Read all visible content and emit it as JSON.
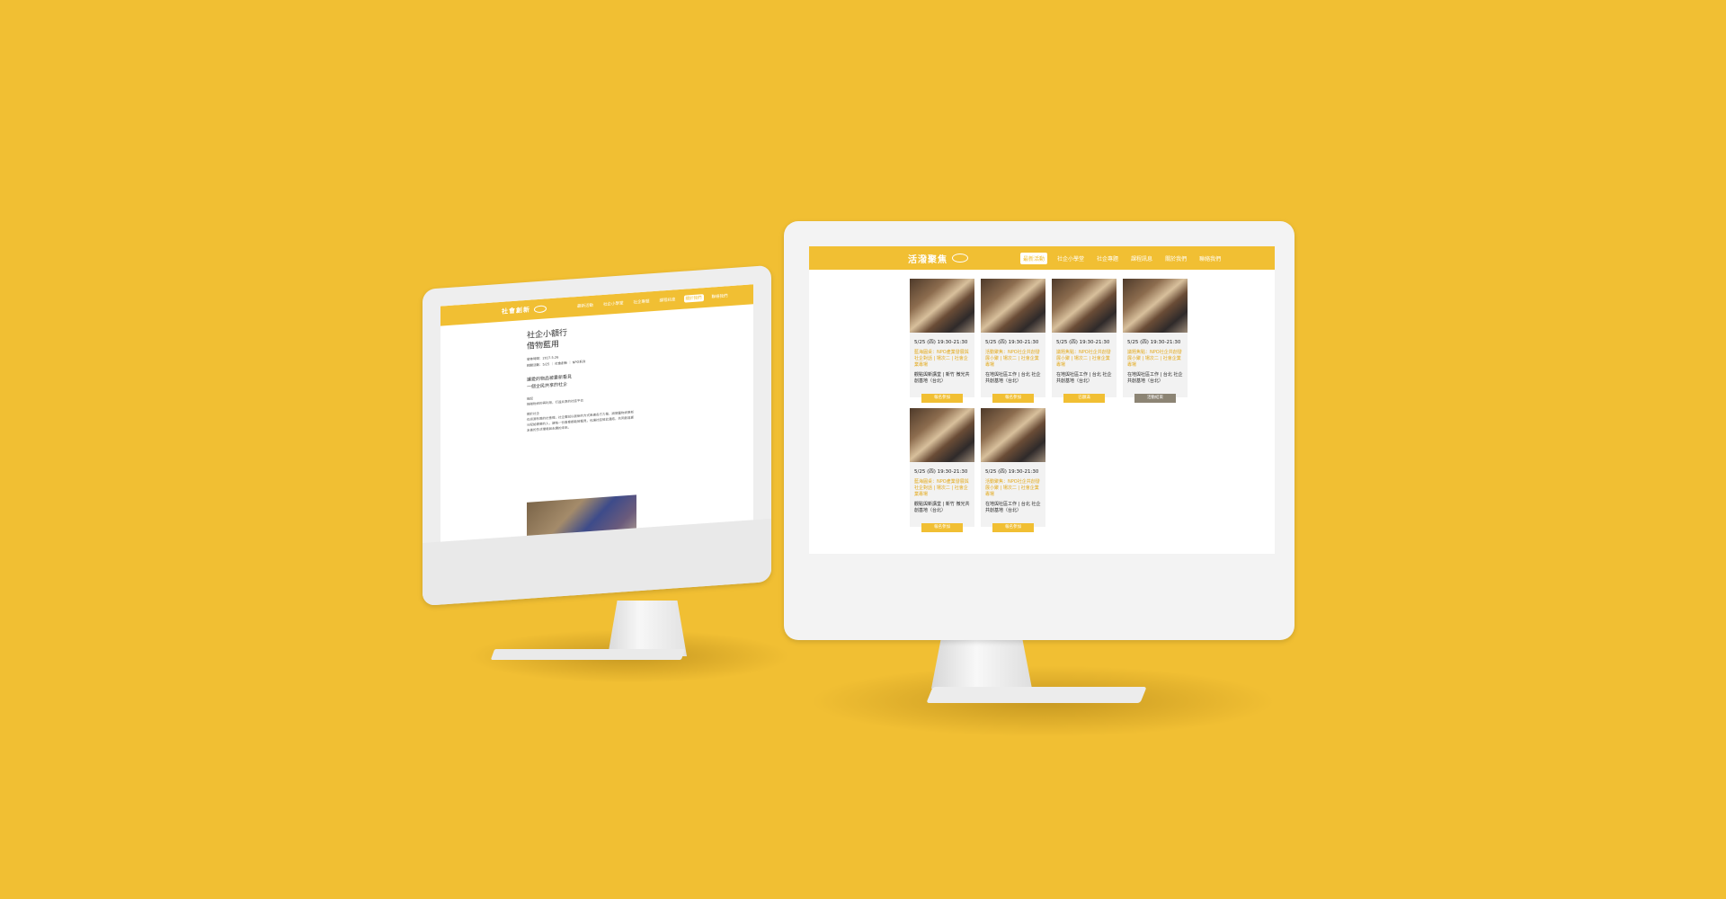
{
  "colors": {
    "background": "#f1bf33",
    "accent": "#f1bf33",
    "button_closed": "#8c8474"
  },
  "small_screen": {
    "logo": "社會創新",
    "nav": [
      "最新活動",
      "社企小學堂",
      "社企專題",
      "課程訊息",
      "關於我們",
      "聯絡我們"
    ],
    "active_nav_index": 4,
    "article": {
      "title_line1": "社企小額行",
      "title_line2": "借物藍用",
      "meta_line1": "發佈時間：2017.5.26",
      "meta_line2": "相關活動：5/25 ｜ 社會創新 ｜ NPO系列",
      "subtitle_line1": "讓愛的物品被重新看見",
      "subtitle_line2": "一個全民共享的社企",
      "body_heading": "緣起",
      "body_line": "捐贈物資的再利用，打造共享的社區平台",
      "body_heading2": "關於社企",
      "body_text": "在資源有限的社會裡，社企嘗試以創新的方式串連各方力量，將閒置物資重新分配給需要的人，讓每一份善意都能被看見，也讓社區彼此連結，共同創造更友善的生活環境與永續的未來。"
    }
  },
  "large_screen": {
    "logo": "活潑聚焦",
    "nav": [
      "最新活動",
      "社企小學堂",
      "社企專題",
      "課程訊息",
      "關於我們",
      "聯絡我們"
    ],
    "active_nav_index": 0,
    "cards": [
      {
        "date": "5/25 (四) 19:30-21:30",
        "title": "藍海圓桌：NPO產業發展與社企對話 | 場次二 | 社會企業專場",
        "location": "觀點與新講堂 | 新竹 微光共創基地（台北）",
        "button": "報名參加",
        "closed": false
      },
      {
        "date": "5/25 (四) 19:30-21:30",
        "title": "活動聚焦：NPO社企共創發展小聚 | 場次二 | 社會企業專場",
        "location": "在地與社區工作 | 台北 社企共創基地（台北）",
        "button": "報名參加",
        "closed": false
      },
      {
        "date": "5/25 (四) 19:30-21:30",
        "title": "議題焦點：NPO社企共創發展小聚 | 場次二 | 社會企業專場",
        "location": "在地與社區工作 | 台北 社企共創基地（台北）",
        "button": "已額滿",
        "closed": false
      },
      {
        "date": "5/25 (四) 19:30-21:30",
        "title": "議題焦點：NPO社企共創發展小聚 | 場次二 | 社會企業專場",
        "location": "在地與社區工作 | 台北 社企共創基地（台北）",
        "button": "活動結束",
        "closed": true
      },
      {
        "date": "5/25 (四) 19:30-21:30",
        "title": "藍海圓桌：NPO產業發展與社企對話 | 場次二 | 社會企業專場",
        "location": "觀點與新講堂 | 新竹 微光共創基地（台北）",
        "button": "報名參加",
        "closed": false
      },
      {
        "date": "5/25 (四) 19:30-21:30",
        "title": "活動聚焦：NPO社企共創發展小聚 | 場次二 | 社會企業專場",
        "location": "在地與社區工作 | 台北 社企共創基地（台北）",
        "button": "報名參加",
        "closed": false
      }
    ]
  }
}
